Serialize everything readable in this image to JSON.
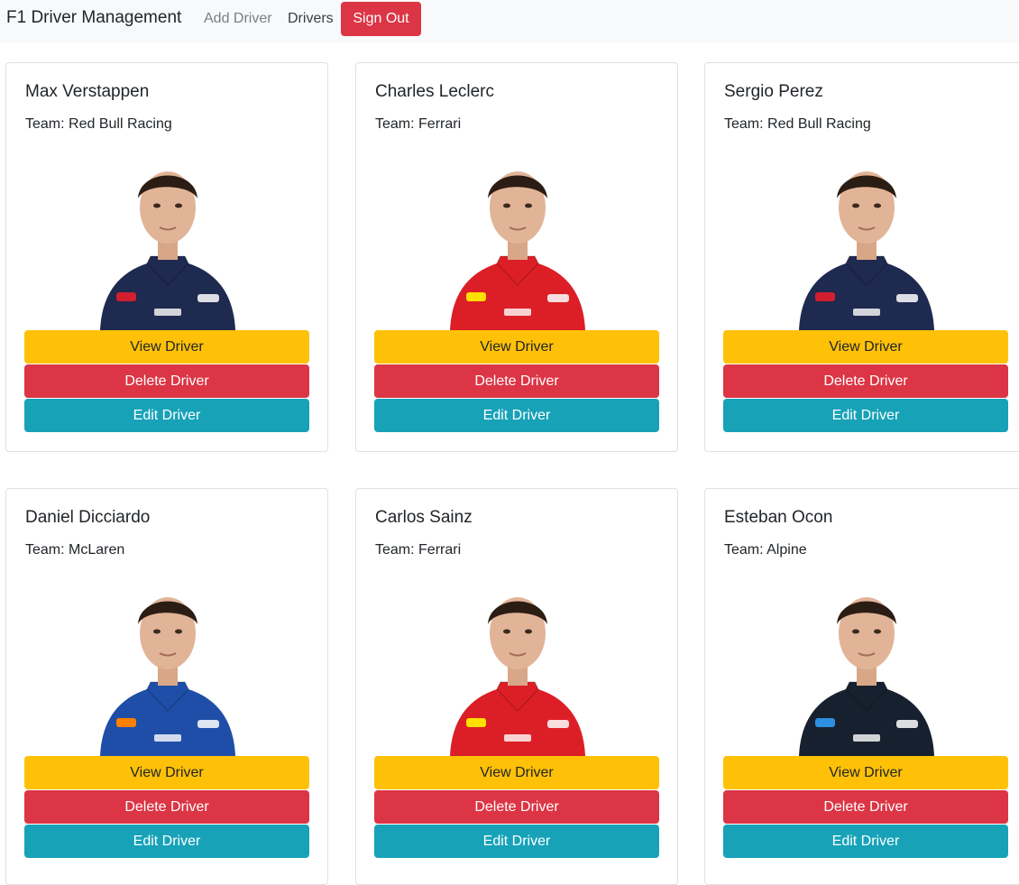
{
  "nav": {
    "brand": "F1 Driver Management",
    "links": [
      "Add Driver",
      "Drivers"
    ],
    "signout": "Sign Out"
  },
  "buttons": {
    "view": "View Driver",
    "delete": "Delete Driver",
    "edit": "Edit Driver"
  },
  "drivers": [
    {
      "name": "Max Verstappen",
      "team": "Team: Red Bull Racing",
      "suit": "#1e2a4f",
      "accent": "#d11f2f"
    },
    {
      "name": "Charles Leclerc",
      "team": "Team: Ferrari",
      "suit": "#dc1f26",
      "accent": "#ffe000"
    },
    {
      "name": "Sergio Perez",
      "team": "Team: Red Bull Racing",
      "suit": "#1e2a4f",
      "accent": "#d11f2f"
    },
    {
      "name": "Daniel Dicciardo",
      "team": "Team: McLaren",
      "suit": "#1f4ea8",
      "accent": "#ff8000"
    },
    {
      "name": "Carlos Sainz",
      "team": "Team: Ferrari",
      "suit": "#dc1f26",
      "accent": "#ffe000"
    },
    {
      "name": "Esteban Ocon",
      "team": "Team: Alpine",
      "suit": "#16202e",
      "accent": "#2d8fe0"
    }
  ]
}
